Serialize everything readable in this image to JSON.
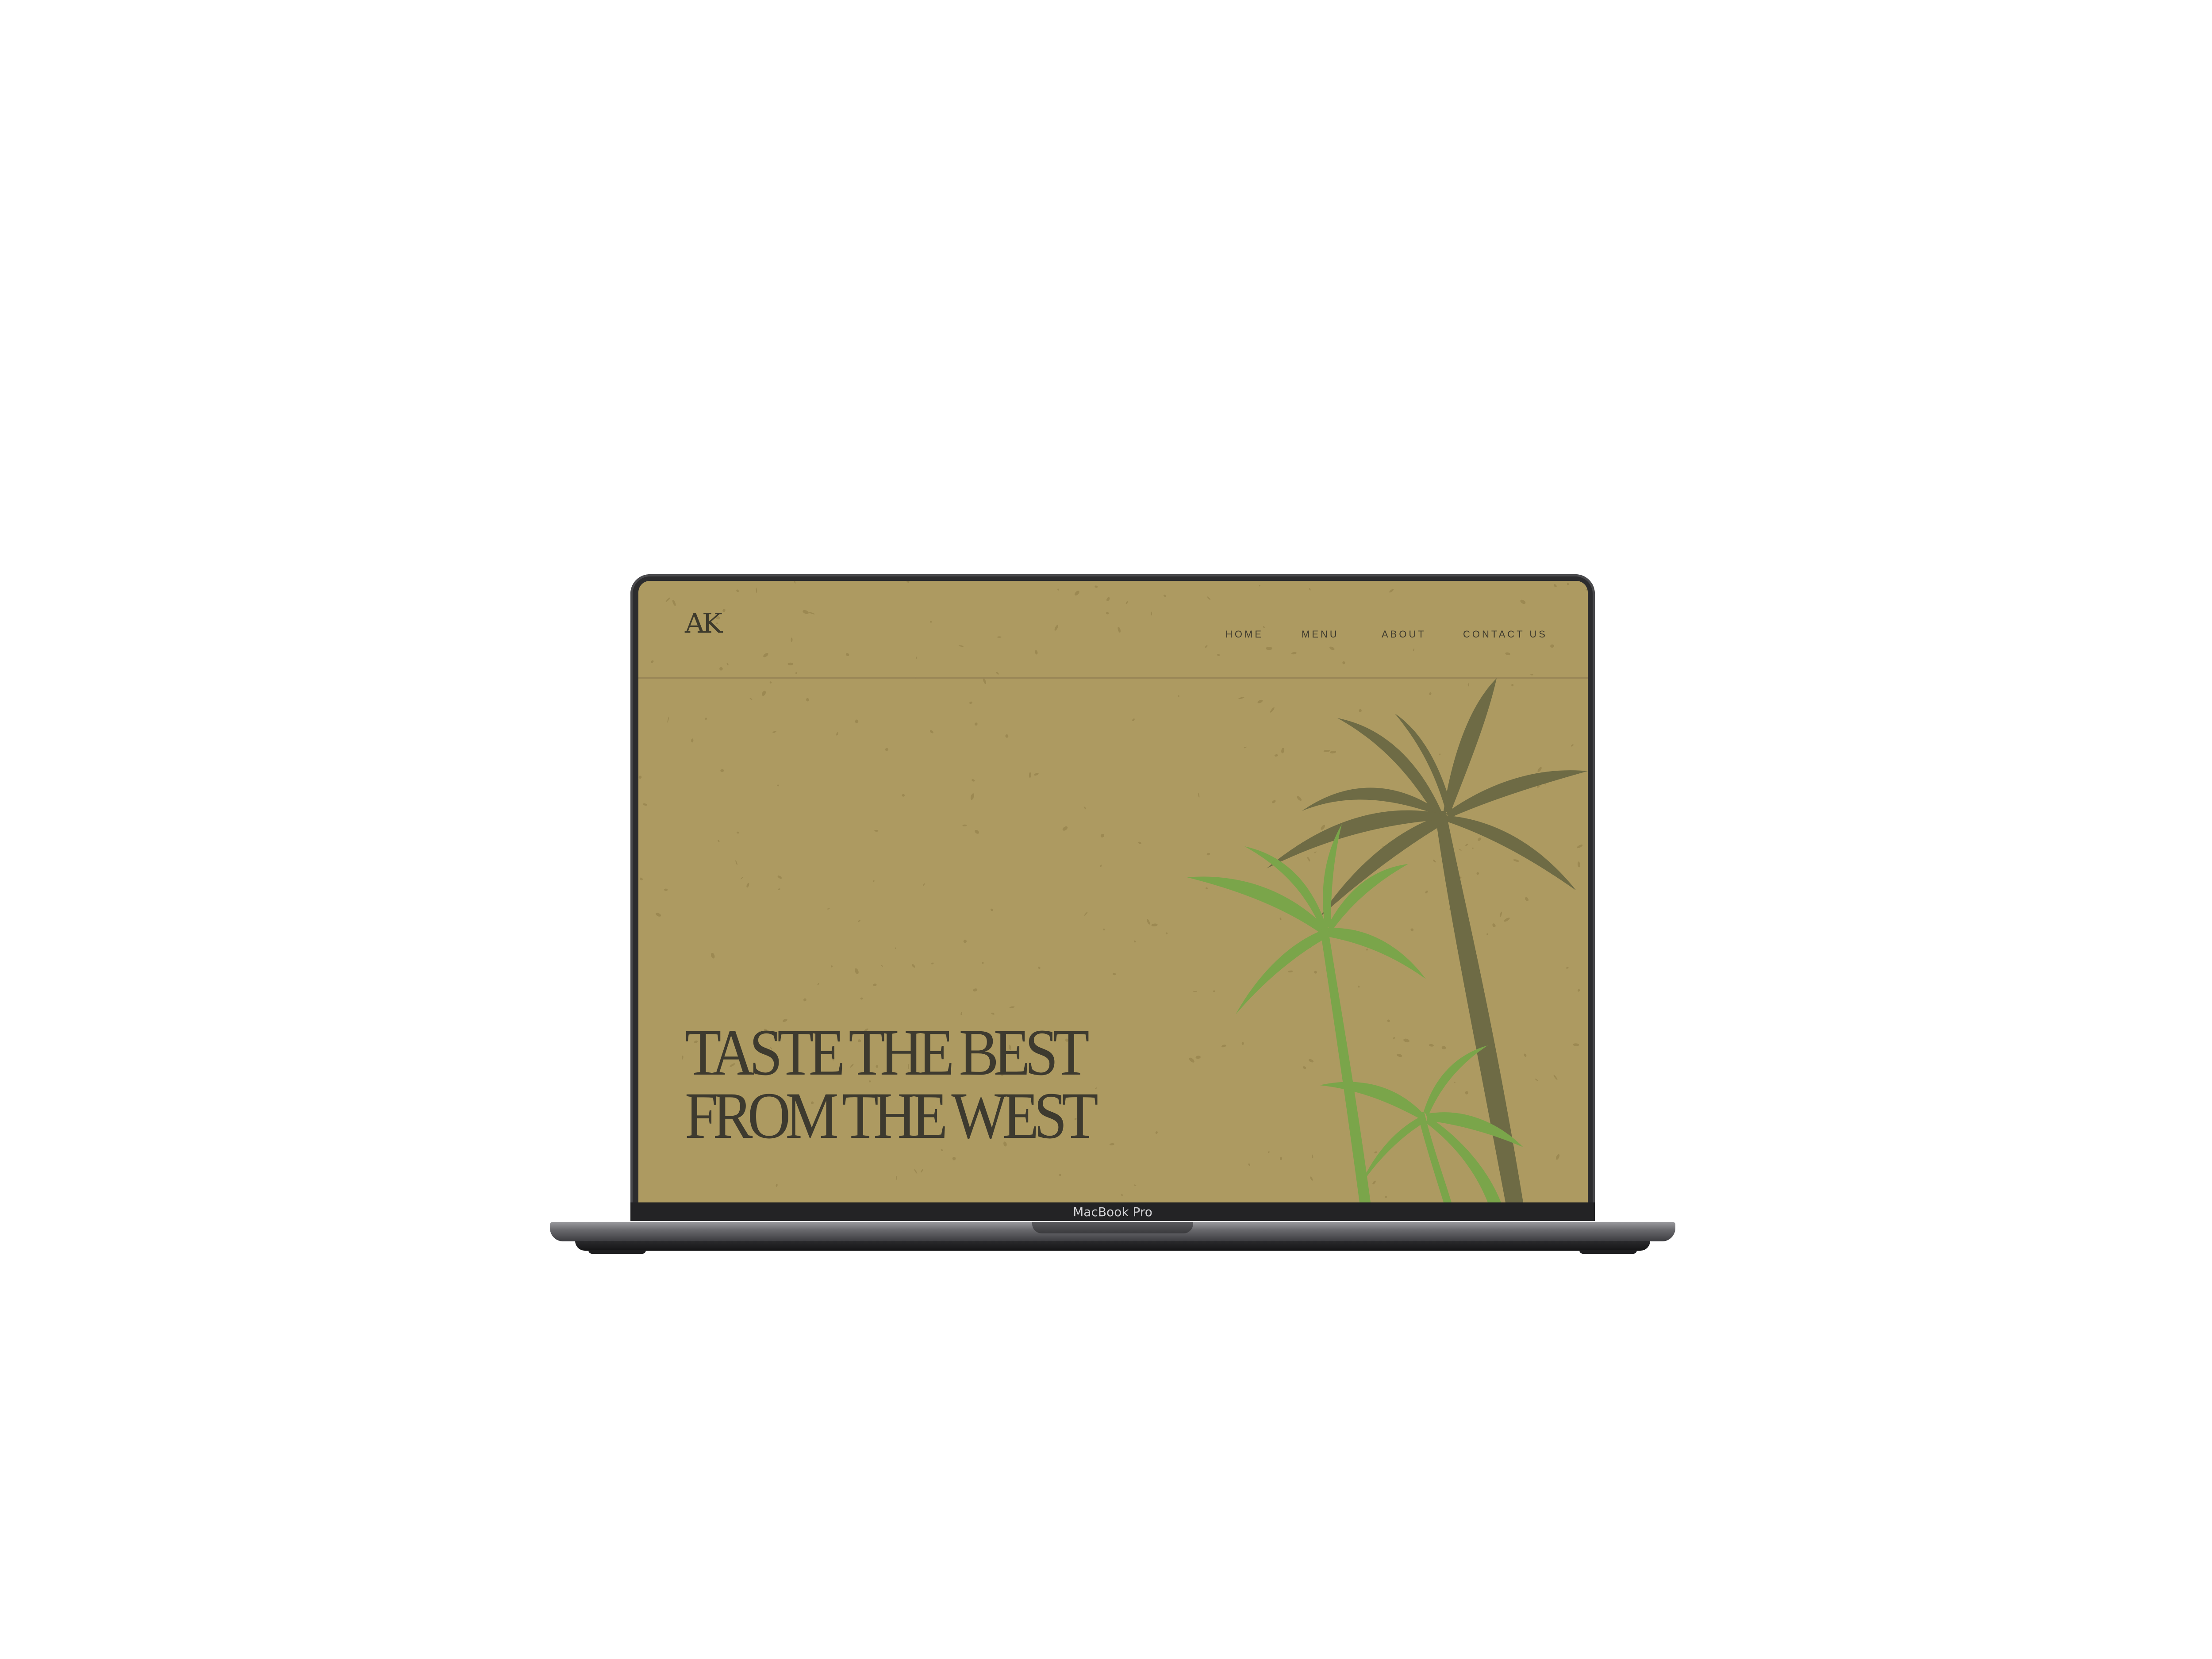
{
  "device": {
    "label": "MacBook Pro"
  },
  "site": {
    "logo": "AK",
    "nav": [
      "HOME",
      "MENU",
      "ABOUT",
      "CONTACT US"
    ],
    "headline": [
      "TASTE THE BEST",
      "FROM THE WEST"
    ]
  },
  "colors": {
    "page_background": "#ffffff",
    "screen_background": "#ad9a61",
    "text_dark": "#3d3a2f",
    "palm_dark": "#6e6b45",
    "palm_green": "#7aa54a",
    "laptop_dark": "#2c2c2e"
  },
  "icons": [
    "palm-tree-illustration",
    "paper-texture"
  ]
}
